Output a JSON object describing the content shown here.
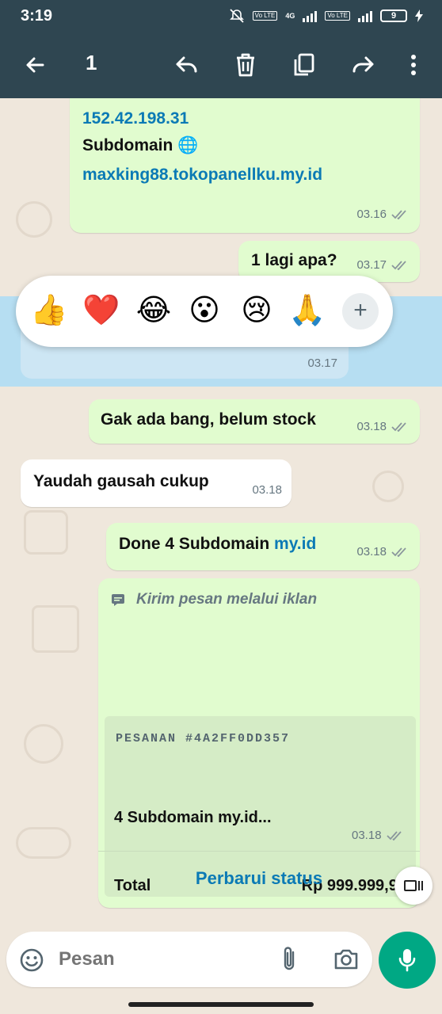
{
  "status_bar": {
    "time": "3:19",
    "network": "4G",
    "volte_1": "Vo LTE",
    "volte_2": "Vo LTE",
    "battery": "9"
  },
  "toolbar": {
    "selected_count": "1"
  },
  "messages": [
    {
      "ip": "152.42.198.31",
      "label": "Subdomain",
      "emoji": "🌐",
      "domain": "maxking88.tokopanellku.my.id",
      "time": "03.16"
    },
    {
      "text": "1 lagi apa?",
      "time": "03.17"
    },
    {
      "time": "03.17"
    },
    {
      "text": "Gak ada bang, belum stock",
      "time": "03.18"
    },
    {
      "text": "Yaudah gausah cukup",
      "time": "03.18"
    },
    {
      "text": "Done 4 Subdomain ",
      "link": "my.id",
      "time": "03.18"
    }
  ],
  "reactions": [
    "👍",
    "❤️",
    "😂",
    "😮",
    "😢",
    "🙏"
  ],
  "reaction_more": "+",
  "order_message": {
    "header": "Kirim pesan melalui iklan",
    "order_id": "PESANAN #4A2FF0DD357",
    "item": "4 Subdomain my.id...",
    "total_label": "Total",
    "total_value": "Rp 999.999,99",
    "time": "03.18",
    "action": "Perbarui status"
  },
  "input": {
    "placeholder": "Pesan"
  },
  "colors": {
    "header_bg": "#2f4651",
    "outgoing_bubble": "#e1fccf",
    "incoming_bubble": "#ffffff",
    "link": "#0b7ab5",
    "accent": "#00a884",
    "selected_highlight": "#b6def2"
  },
  "icons": [
    "back-arrow-icon",
    "reply-icon",
    "delete-icon",
    "copy-icon",
    "forward-icon",
    "more-vert-icon",
    "emoji-icon",
    "attach-icon",
    "camera-icon",
    "mic-icon",
    "double-check-icon",
    "ad-message-icon",
    "video-pip-icon"
  ]
}
